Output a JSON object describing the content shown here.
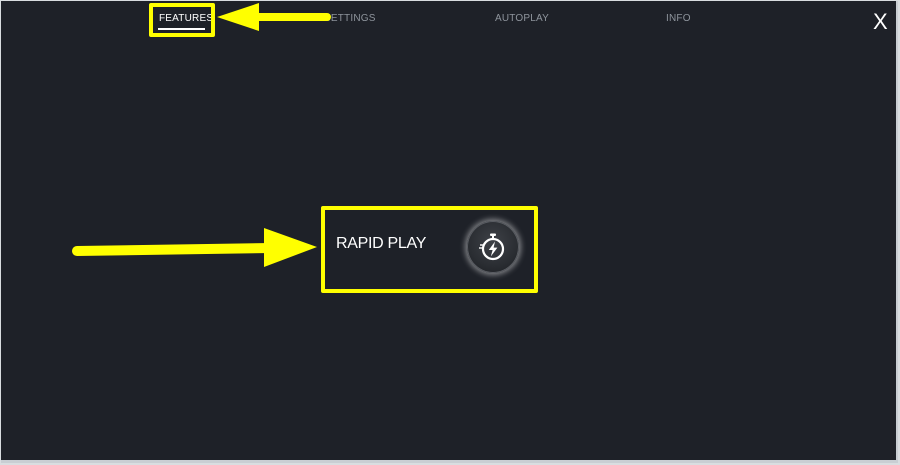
{
  "tabs": [
    {
      "label": "FEATURES",
      "active": true
    },
    {
      "label": "SETTINGS",
      "active": false
    },
    {
      "label": "AUTOPLAY",
      "active": false
    },
    {
      "label": "INFO",
      "active": false
    }
  ],
  "close_label": "X",
  "rapid_play": {
    "label": "RAPID PLAY",
    "icon": "stopwatch-bolt-icon"
  },
  "colors": {
    "background": "#1e2128",
    "annotation": "#ffff00",
    "active_tab": "#ffffff",
    "inactive_tab": "#8e949c"
  }
}
